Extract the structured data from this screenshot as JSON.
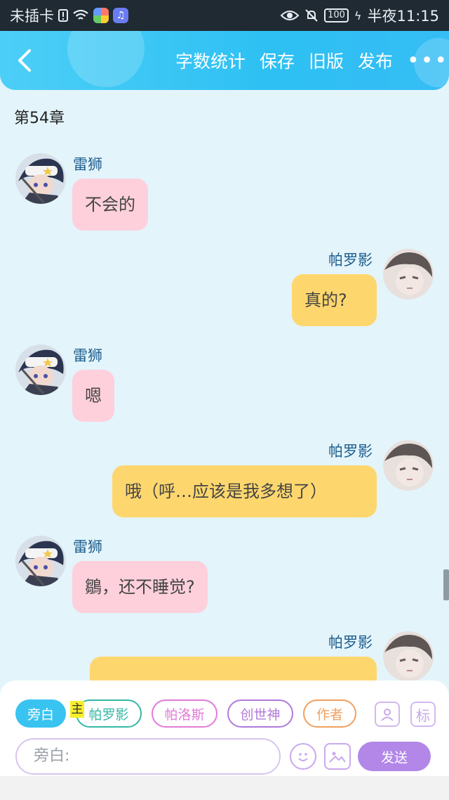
{
  "status_bar": {
    "carrier": "未插卡",
    "battery": "100",
    "time": "半夜11:15"
  },
  "header": {
    "back_icon": "chevron-left-icon",
    "actions": [
      "字数统计",
      "保存",
      "旧版",
      "发布"
    ],
    "more": "•••"
  },
  "chapter_title": "第54章",
  "messages": [
    {
      "side": "left",
      "name": "雷狮",
      "text": "不会的",
      "color": "#fdd0dc"
    },
    {
      "side": "right",
      "name": "帕罗影",
      "text": "真的?",
      "color": "#fdd76e"
    },
    {
      "side": "left",
      "name": "雷狮",
      "text": "嗯",
      "color": "#fdd0dc"
    },
    {
      "side": "right",
      "name": "帕罗影",
      "text": "哦（呼…应该是我多想了）",
      "color": "#fdd76e"
    },
    {
      "side": "left",
      "name": "雷狮",
      "text": "鶵，还不睡觉?",
      "color": "#fdd0dc"
    },
    {
      "side": "right",
      "name": "帕罗影",
      "text": "",
      "color": "#fdd76e"
    }
  ],
  "composer": {
    "roles": [
      {
        "label": "旁白",
        "color": "#39c3f1",
        "active": true
      },
      {
        "label": "帕罗影",
        "color": "#35b8a6",
        "active": false
      },
      {
        "label": "帕洛斯",
        "color": "#e27bd8",
        "active": false
      },
      {
        "label": "创世神",
        "color": "#b07ad8",
        "active": false
      },
      {
        "label": "作者",
        "color": "#f0a060",
        "active": false
      }
    ],
    "main_tag": "主",
    "tag_button": "标",
    "input_placeholder": "旁白:",
    "send_label": "发送"
  }
}
